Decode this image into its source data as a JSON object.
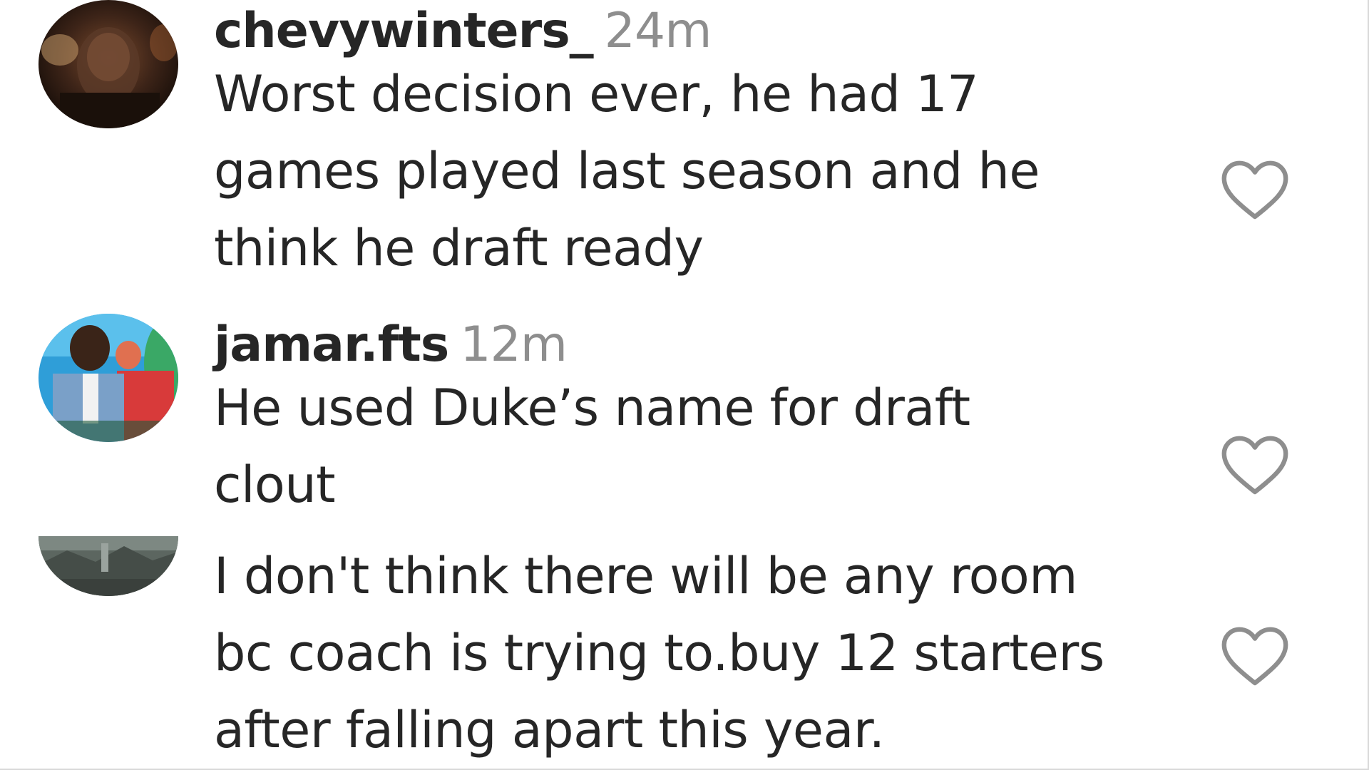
{
  "comments": [
    {
      "username": "chevywinters_",
      "time": "24m",
      "text": "Worst decision ever, he had 17\ngames played last season and he\nthink he draft ready",
      "avatar_icon": "dark-photo-avatar",
      "like_icon": "heart-outline-icon"
    },
    {
      "username": "jamar.fts",
      "time": "12m",
      "text": "He used Duke’s name for draft\nclout",
      "avatar_icon": "colorful-photo-avatar",
      "like_icon": "heart-outline-icon"
    },
    {
      "username": "",
      "time": "",
      "text": "I don't think there will be any room\nbc coach is trying to.buy 12 starters\nafter falling apart this year.",
      "avatar_icon": "landscape-photo-avatar",
      "like_icon": "heart-outline-icon"
    }
  ],
  "colors": {
    "text": "#262626",
    "muted": "#8e8e8e",
    "heart_stroke": "#8e8e8e",
    "border": "#d9d9d9"
  }
}
